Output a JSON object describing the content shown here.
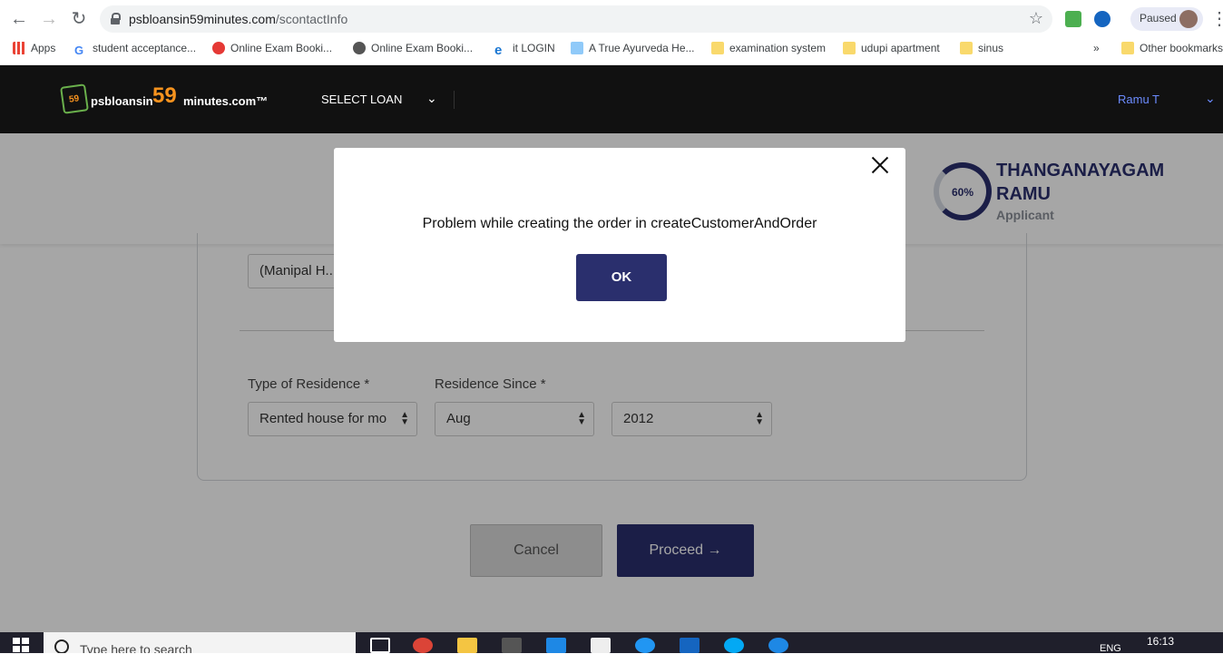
{
  "browser": {
    "url_host": "psbloansin59minutes.com",
    "url_path": "/scontactInfo",
    "profile_status": "Paused",
    "bookmarks": [
      {
        "label": "Apps",
        "icon": "apps-grid-icon"
      },
      {
        "label": "student acceptance...",
        "icon": "google-icon"
      },
      {
        "label": "Online Exam Booki...",
        "icon": "airtel-icon"
      },
      {
        "label": "Online Exam Booki...",
        "icon": "globe-icon"
      },
      {
        "label": "it LOGIN",
        "icon": "ie-icon"
      },
      {
        "label": "A True Ayurveda He...",
        "icon": "site-icon"
      },
      {
        "label": "examination system",
        "icon": "folder-icon"
      },
      {
        "label": "udupi apartment",
        "icon": "folder-icon"
      },
      {
        "label": "sinus",
        "icon": "folder-icon"
      }
    ],
    "overflow": "»",
    "other_bookmarks": "Other bookmarks"
  },
  "app": {
    "logo_prefix": "psbloansin",
    "logo_number": "59",
    "logo_suffix": "minutes.com™",
    "logo_badge": "59",
    "select_loan": "SELECT LOAN",
    "user_name": "Ramu T"
  },
  "applicant": {
    "progress_label": "60%",
    "progress_value": 0.6,
    "name": "THANGANAYAGAM RAMU",
    "role": "Applicant"
  },
  "form": {
    "hospital_value": "(Manipal H...",
    "type_of_residence_label": "Type of Residence *",
    "residence_since_label": "Residence Since *",
    "type_of_residence_value": "Rented house for mo",
    "residence_month_value": "Aug",
    "residence_year_value": "2012",
    "cancel_label": "Cancel",
    "proceed_label": "Proceed →"
  },
  "modal": {
    "message": "Problem while creating the order in createCustomerAndOrder",
    "ok_label": "OK"
  },
  "taskbar": {
    "search_placeholder": "Type here to search",
    "language": "ENG",
    "time": "16:13"
  },
  "colors": {
    "brand_navy": "#2a2f6d",
    "brand_orange": "#f7931e",
    "header_bg": "#111111"
  }
}
